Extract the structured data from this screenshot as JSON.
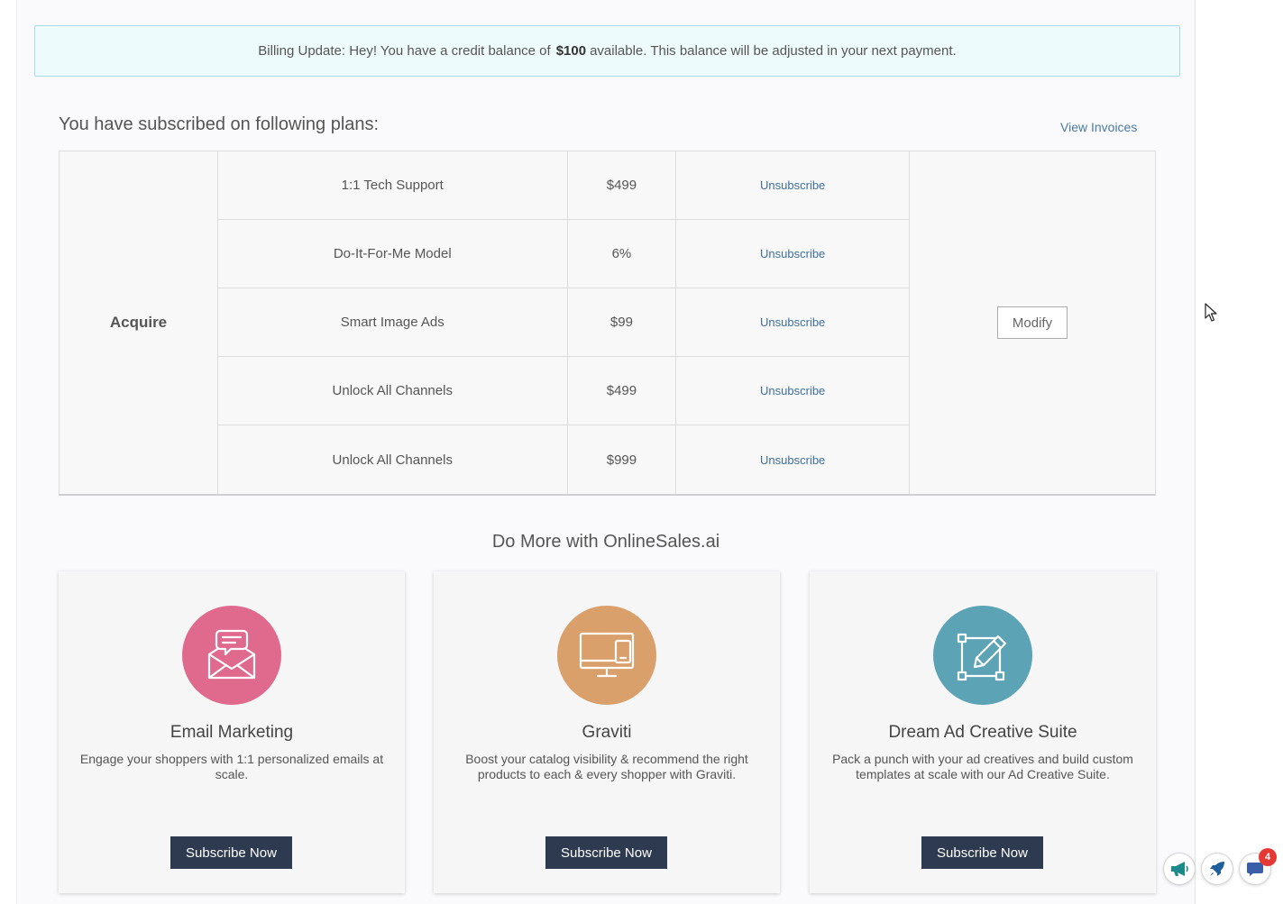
{
  "banner": {
    "prefix": "Billing Update: Hey! You have a credit balance of",
    "amount": "$100",
    "suffix": "available. This balance will be adjusted in your next payment."
  },
  "plans": {
    "heading": "You have subscribed on following plans:",
    "view_invoices": "View Invoices",
    "group": "Acquire",
    "modify_label": "Modify",
    "rows": [
      {
        "name": "1:1 Tech Support",
        "price": "$499",
        "action": "Unsubscribe"
      },
      {
        "name": "Do-It-For-Me Model",
        "price": "6%",
        "action": "Unsubscribe"
      },
      {
        "name": "Smart Image Ads",
        "price": "$99",
        "action": "Unsubscribe"
      },
      {
        "name": "Unlock All Channels",
        "price": "$499",
        "action": "Unsubscribe"
      },
      {
        "name": "Unlock All Channels",
        "price": "$999",
        "action": "Unsubscribe"
      }
    ]
  },
  "more": {
    "heading": "Do More with OnlineSales.ai",
    "cards": [
      {
        "title": "Email Marketing",
        "desc": "Engage your shoppers with 1:1 personalized emails at scale.",
        "button": "Subscribe Now",
        "icon": "email-chat-icon",
        "color": "#e06a8e"
      },
      {
        "title": "Graviti",
        "desc": "Boost your catalog visibility & recommend the right products to each & every shopper with Graviti.",
        "button": "Subscribe Now",
        "icon": "devices-icon",
        "color": "#d9a06b"
      },
      {
        "title": "Dream Ad Creative Suite",
        "desc": "Pack a punch with your ad creatives and build custom templates at scale with our Ad Creative Suite.",
        "button": "Subscribe Now",
        "icon": "design-edit-icon",
        "color": "#5ba3b5"
      }
    ]
  },
  "floating": {
    "notification_count": "4",
    "icons": [
      "megaphone-icon",
      "rocket-icon",
      "chat-icon"
    ]
  }
}
